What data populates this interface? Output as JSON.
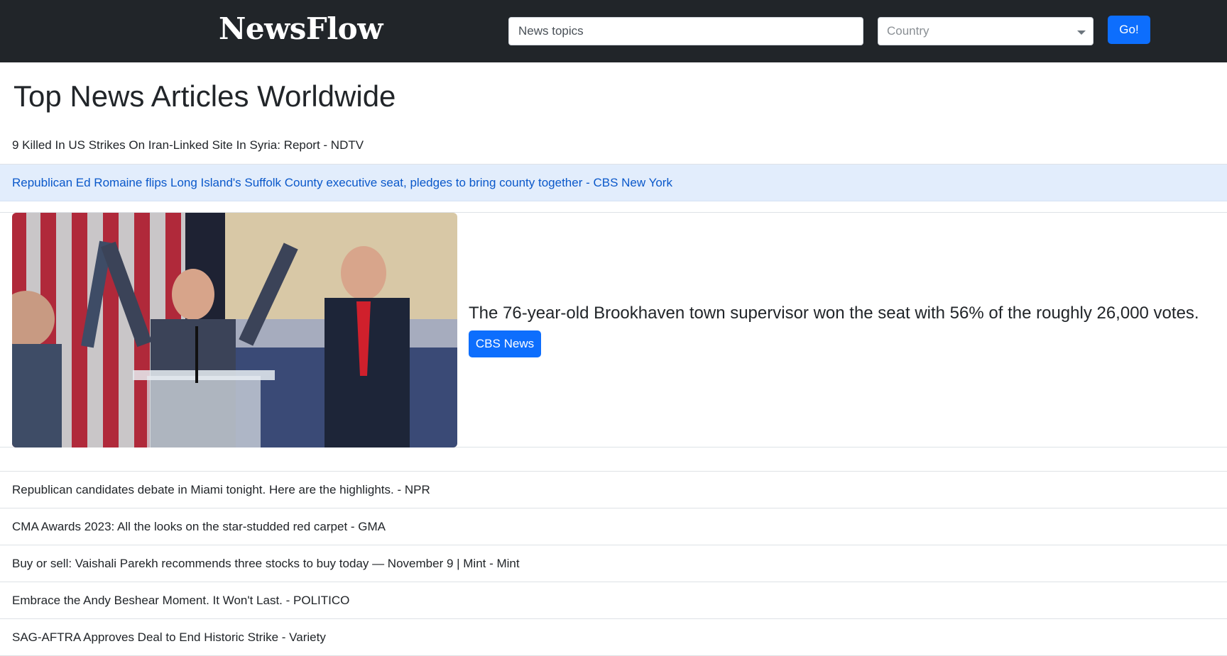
{
  "header": {
    "brand": "NewsFlow",
    "search_placeholder": "News topics",
    "country_placeholder": "Country",
    "go_label": "Go!"
  },
  "main": {
    "title": "Top News Articles Worldwide",
    "articles": [
      {
        "text": "9 Killed In US Strikes On Iran-Linked Site In Syria: Report - NDTV"
      },
      {
        "text": "Republican Ed Romaine flips Long Island's Suffolk County executive seat, pledges to bring county together - CBS New York",
        "active": true
      },
      {
        "text": "Republican candidates debate in Miami tonight. Here are the highlights. - NPR"
      },
      {
        "text": "CMA Awards 2023: All the looks on the star-studded red carpet - GMA"
      },
      {
        "text": "Buy or sell: Vaishali Parekh recommends three stocks to buy today — November 9 | Mint - Mint"
      },
      {
        "text": "Embrace the Andy Beshear Moment. It Won't Last. - POLITICO"
      },
      {
        "text": "SAG-AFTRA Approves Deal to End Historic Strike - Variety"
      }
    ],
    "featured": {
      "description": "The 76-year-old Brookhaven town supervisor won the seat with 56% of the roughly 26,000 votes.",
      "source_label": "CBS News"
    }
  },
  "colors": {
    "navbar": "#212529",
    "accent": "#0d6efd",
    "active_row_bg": "#e2edfc",
    "active_row_text": "#0a58ca"
  }
}
